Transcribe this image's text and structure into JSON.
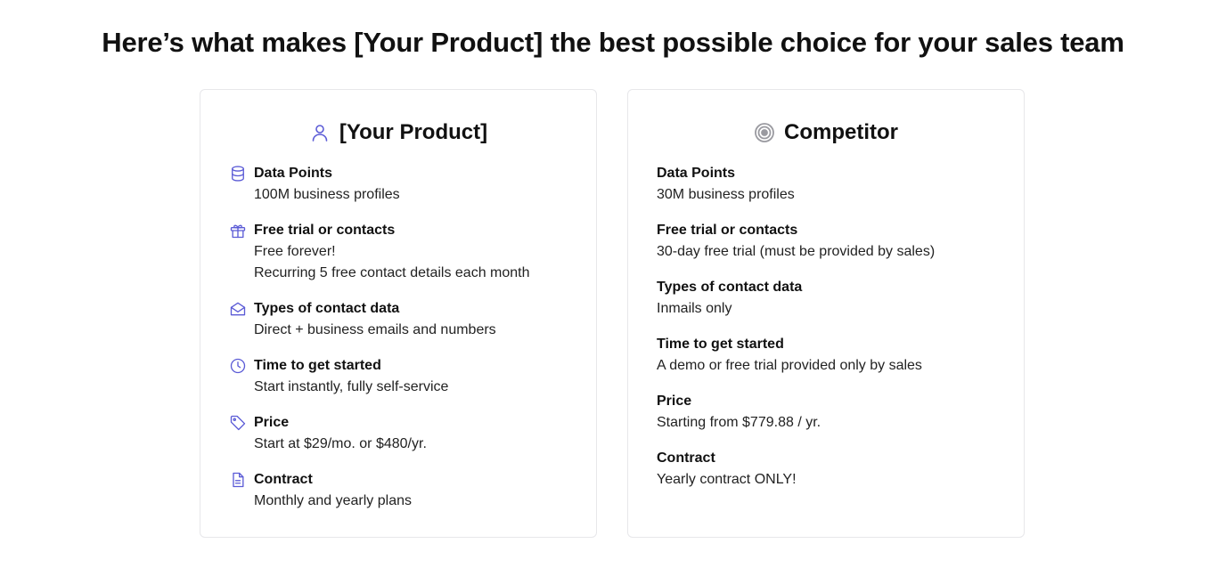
{
  "headline": "Here’s what makes [Your Product] the best possible choice for your sales team",
  "colors": {
    "accent": "#5b5bd6",
    "competitor_icon": "#9a9aa0",
    "border": "#e7e7ea"
  },
  "our_product": {
    "title": "[Your Product]",
    "icon": "user-icon",
    "rows": [
      {
        "label": "Data Points",
        "icon": "database-icon",
        "values": [
          "100M business profiles"
        ]
      },
      {
        "label": "Free trial or contacts",
        "icon": "gift-icon",
        "values": [
          "Free forever!",
          "Recurring 5 free contact details each month"
        ]
      },
      {
        "label": "Types of contact data",
        "icon": "envelope-open-icon",
        "values": [
          "Direct + business emails and numbers"
        ]
      },
      {
        "label": "Time to get started",
        "icon": "clock-icon",
        "values": [
          "Start instantly, fully self-service"
        ]
      },
      {
        "label": "Price",
        "icon": "tag-icon",
        "values": [
          "Start at $29/mo. or $480/yr."
        ]
      },
      {
        "label": "Contract",
        "icon": "document-icon",
        "values": [
          "Monthly and yearly plans"
        ]
      }
    ]
  },
  "competitor": {
    "title": "Competitor",
    "icon": "target-icon",
    "rows": [
      {
        "label": "Data Points",
        "values": [
          "30M business profiles"
        ]
      },
      {
        "label": "Free trial or contacts",
        "values": [
          "30-day free trial (must be provided by sales)"
        ]
      },
      {
        "label": "Types of contact data",
        "values": [
          "Inmails only"
        ]
      },
      {
        "label": "Time to get started",
        "values": [
          "A demo or free trial provided only by sales"
        ]
      },
      {
        "label": "Price",
        "values": [
          "Starting from $779.88 / yr."
        ]
      },
      {
        "label": "Contract",
        "values": [
          "Yearly contract ONLY!"
        ]
      }
    ]
  }
}
